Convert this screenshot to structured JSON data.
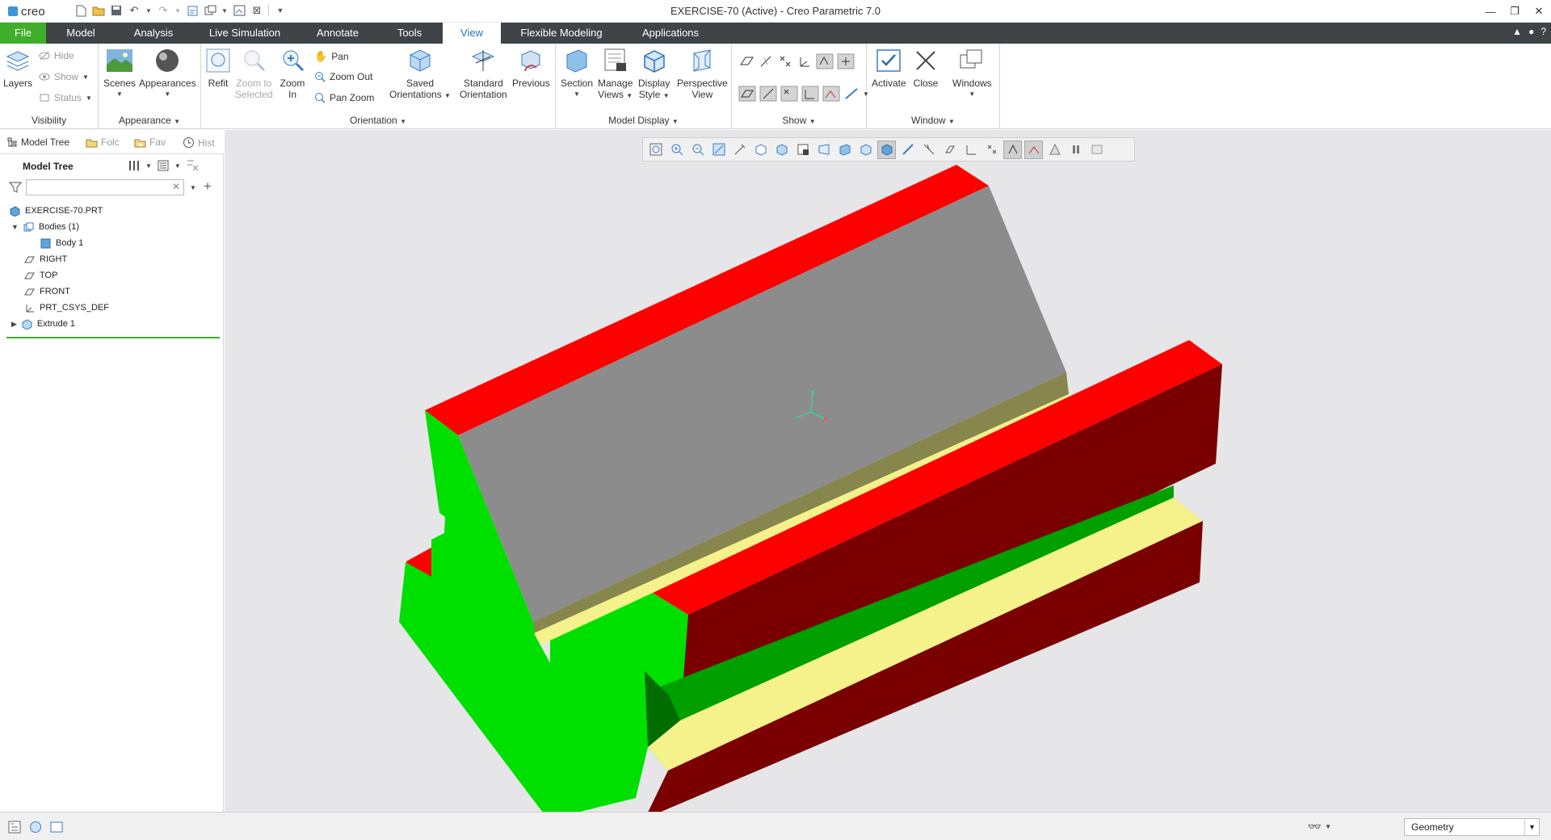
{
  "app": {
    "logo_text": "creo",
    "window_title": "EXERCISE-70 (Active) - Creo Parametric 7.0"
  },
  "tabs": [
    {
      "label": "File"
    },
    {
      "label": "Model"
    },
    {
      "label": "Analysis"
    },
    {
      "label": "Live Simulation"
    },
    {
      "label": "Annotate"
    },
    {
      "label": "Tools"
    },
    {
      "label": "View"
    },
    {
      "label": "Flexible Modeling"
    },
    {
      "label": "Applications"
    }
  ],
  "ribbon": {
    "visibility": {
      "label": "Visibility",
      "layers": "Layers",
      "hide": "Hide",
      "show": "Show",
      "status": "Status"
    },
    "appearance": {
      "label": "Appearance",
      "scenes": "Scenes",
      "appearances": "Appearances"
    },
    "orientation": {
      "label": "Orientation",
      "refit": "Refit",
      "zoom_selected_1": "Zoom to",
      "zoom_selected_2": "Selected",
      "zoom_in_1": "Zoom",
      "zoom_in_2": "In",
      "pan": "Pan",
      "zoom_out": "Zoom Out",
      "pan_zoom": "Pan Zoom",
      "saved_1": "Saved",
      "saved_2": "Orientations",
      "standard_1": "Standard",
      "standard_2": "Orientation",
      "previous": "Previous"
    },
    "model_display": {
      "label": "Model Display",
      "section": "Section",
      "manage_1": "Manage",
      "manage_2": "Views",
      "display_1": "Display",
      "display_2": "Style",
      "persp_1": "Perspective",
      "persp_2": "View"
    },
    "show": {
      "label": "Show"
    },
    "window": {
      "label": "Window",
      "activate": "Activate",
      "close": "Close",
      "windows": "Windows"
    }
  },
  "navigator": {
    "tabs": [
      "Model Tree",
      "Folc",
      "Fav",
      "Hist"
    ],
    "panel_title": "Model Tree",
    "filter_value": ""
  },
  "tree": [
    {
      "label": "EXERCISE-70.PRT"
    },
    {
      "label": "Bodies (1)"
    },
    {
      "label": "Body 1"
    },
    {
      "label": "RIGHT"
    },
    {
      "label": "TOP"
    },
    {
      "label": "FRONT"
    },
    {
      "label": "PRT_CSYS_DEF"
    },
    {
      "label": "Extrude 1"
    }
  ],
  "status": {
    "selection_filter": "Geometry"
  },
  "colors": {
    "file_tab": "#3fae2a",
    "tab_bar": "#3f4448",
    "viewport": "#e6e6e8",
    "face_red": "#ff0000",
    "face_green": "#00e000",
    "face_dark_red": "#7a0000",
    "face_gray": "#8c8c8c",
    "face_yellow": "#f5f28c"
  }
}
